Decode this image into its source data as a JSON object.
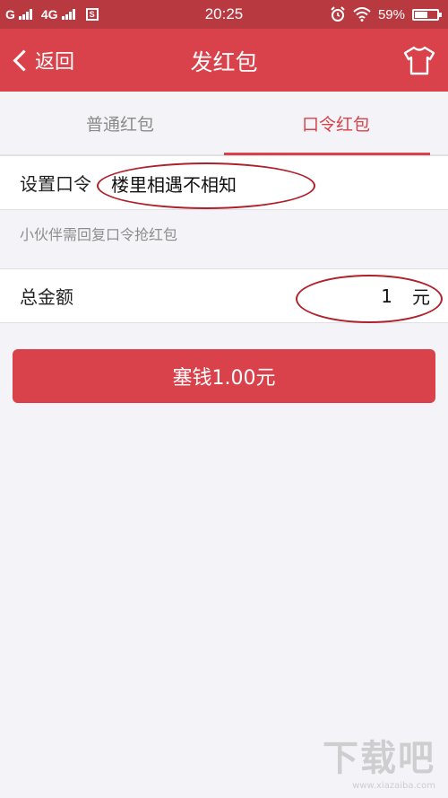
{
  "status_bar": {
    "carrier": "G",
    "network": "4G",
    "time": "20:25",
    "battery": "59%",
    "battery_level": 0.59
  },
  "nav": {
    "back_label": "返回",
    "title": "发红包"
  },
  "tabs": [
    {
      "label": "普通红包",
      "active": false
    },
    {
      "label": "口令红包",
      "active": true
    }
  ],
  "form": {
    "code_label": "设置口令",
    "code_value": "楼里相遇不相知",
    "hint": "小伙伴需回复口令抢红包",
    "amount_label": "总金额",
    "amount_value": "1",
    "amount_unit": "元"
  },
  "submit_label": "塞钱1.00元",
  "watermark": {
    "logo_text": "下载吧",
    "url": "www.xiazaiba.com"
  },
  "colors": {
    "accent": "#d9424a",
    "status_bar": "#b8393f",
    "annotation": "#b0202a"
  }
}
